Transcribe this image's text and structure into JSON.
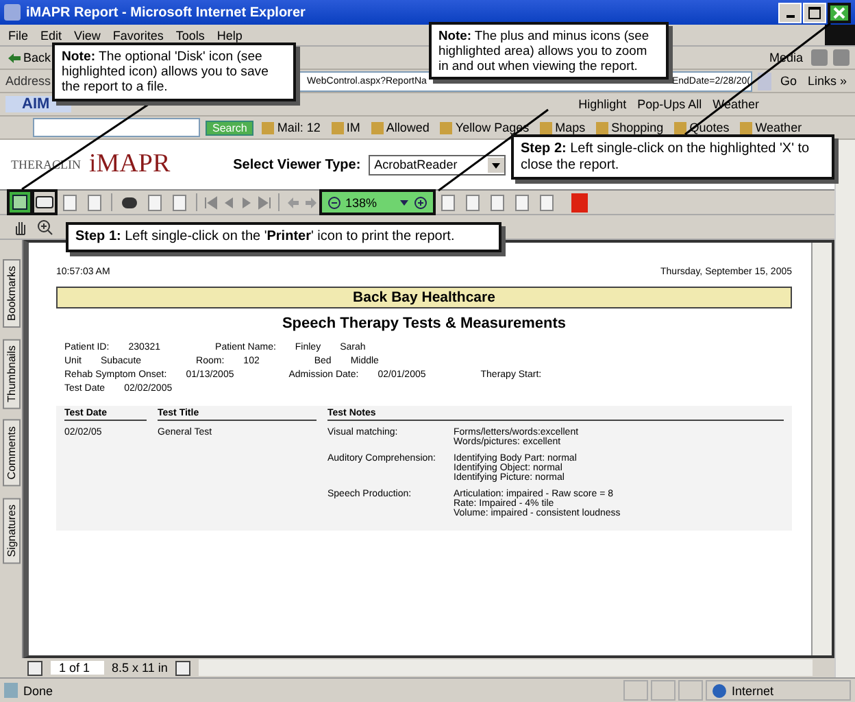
{
  "window": {
    "title": "iMAPR Report - Microsoft Internet Explorer",
    "close_highlighted": true
  },
  "menu": [
    "File",
    "Edit",
    "View",
    "Favorites",
    "Tools",
    "Help"
  ],
  "toolbar": {
    "back": "Back",
    "media": "Media"
  },
  "address_bar": {
    "label": "Address",
    "url_start": "WebControl.aspx?ReportNa",
    "url_end": "EndDate=2/28/20(",
    "go": "Go",
    "links": "Links »"
  },
  "aim_bar": {
    "logo": "AIM",
    "items": [
      "Highlight",
      "Pop-Ups All",
      "Weather"
    ]
  },
  "search_bar": {
    "search": "Search",
    "items": [
      "Mail: 12",
      "IM",
      "Allowed",
      "Yellow Pages",
      "Maps",
      "Shopping",
      "Quotes",
      "Weather"
    ]
  },
  "page": {
    "logo_brand": "THERACLIN",
    "logo_product": "iMAPR",
    "viewer_label": "Select Viewer Type:",
    "viewer_value": "AcrobatReader"
  },
  "viewer": {
    "save_highlighted": true,
    "zoom": "138%",
    "zoom_highlighted": true,
    "side_tabs": [
      "Bookmarks",
      "Thumbnails",
      "Comments",
      "Signatures"
    ],
    "page_count": "1 of 1",
    "page_size": "8.5 x 11 in"
  },
  "report": {
    "time": "10:57:03 AM",
    "date": "Thursday, September 15, 2005",
    "facility": "Back Bay Healthcare",
    "title": "Speech Therapy Tests & Measurements",
    "field_rows": [
      [
        {
          "label": "Patient ID:",
          "values": [
            "230321"
          ]
        },
        {
          "label": "Patient Name:",
          "values": [
            "Finley",
            "Sarah"
          ]
        }
      ],
      [
        {
          "label": "Unit",
          "values": [
            "Subacute"
          ]
        },
        {
          "label": "Room:",
          "values": [
            "102"
          ]
        },
        {
          "label": "Bed",
          "values": [
            "Middle"
          ]
        }
      ],
      [
        {
          "label": "Rehab Symptom Onset:",
          "values": [
            "01/13/2005"
          ]
        },
        {
          "label": "Admission Date:",
          "values": [
            "02/01/2005"
          ]
        },
        {
          "label": "Therapy Start:"
        }
      ],
      [
        {
          "label": "Test Date",
          "values": [
            "02/02/2005"
          ]
        }
      ]
    ],
    "columns": [
      "Test Date",
      "Test Title",
      "Test Notes"
    ],
    "rows": [
      {
        "date": "02/02/05",
        "title": "General Test",
        "notes": [
          {
            "label": "Visual matching:",
            "values": [
              "Forms/letters/words:excellent",
              "Words/pictures: excellent"
            ]
          },
          {
            "label": "Auditory Comprehension:",
            "values": [
              "Identifying Body Part: normal",
              "Identifying Object: normal",
              "Identifying Picture: normal"
            ]
          },
          {
            "label": "Speech Production:",
            "values": [
              "Articulation: impaired - Raw score = 8",
              "Rate: Impaired - 4% tile",
              "Volume: impaired - consistent loudness"
            ]
          }
        ]
      }
    ]
  },
  "callouts": [
    {
      "kind": "disk",
      "text": "**Note:** The optional 'Disk' icon (see highlighted icon) allows you to save the report to a file."
    },
    {
      "kind": "zoom",
      "text": "**Note:** The plus and minus icons (see highlighted area) allows you to zoom in and out when viewing the report."
    },
    {
      "kind": "close",
      "text": "**Step 2:** Left single-click on the highlighted 'X' to close the report."
    },
    {
      "kind": "print",
      "text": "**Step 1:** Left single-click on the '**Printer**' icon to print the report."
    }
  ],
  "status_bar": {
    "text": "Done",
    "zone": "Internet"
  }
}
